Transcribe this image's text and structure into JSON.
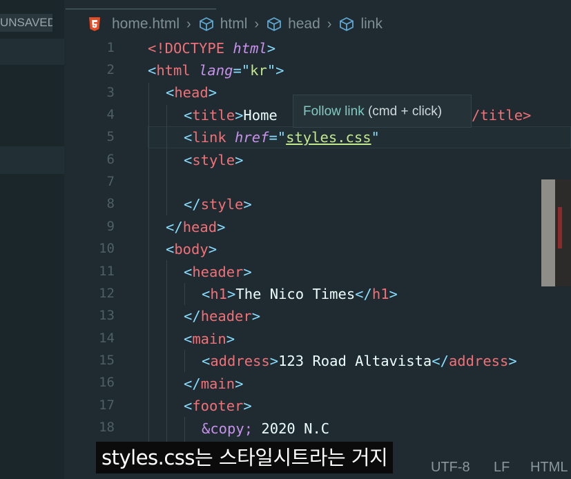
{
  "sidebar": {
    "unsaved_label": "UNSAVED"
  },
  "breadcrumb": {
    "file": "home.html",
    "items": [
      "html",
      "head",
      "link"
    ]
  },
  "line_numbers": [
    "1",
    "2",
    "3",
    "4",
    "5",
    "6",
    "7",
    "8",
    "9",
    "10",
    "11",
    "12",
    "13",
    "14",
    "15",
    "16",
    "17",
    "18"
  ],
  "code": {
    "l1": {
      "open": "<!DOCTYPE ",
      "kw": "html",
      "close": ">"
    },
    "l2": {
      "lt": "<",
      "tag": "html",
      "attr": " lang",
      "eq": "=",
      "q1": "\"",
      "val": "kr",
      "q2": "\"",
      "gt": ">"
    },
    "l3": {
      "lt": "<",
      "tag": "head",
      "gt": ">"
    },
    "l4": {
      "lt": "<",
      "tag": "title",
      "gt": ">",
      "text": "Home",
      "tail": "/title>"
    },
    "l5": {
      "lt": "<",
      "tag": "link",
      "attr": " href",
      "eq": "=",
      "q1": "\"",
      "val": "styles.css",
      "q2": "\""
    },
    "l6": {
      "lt": "<",
      "tag": "style",
      "gt": ">"
    },
    "l8": {
      "lt": "</",
      "tag": "style",
      "gt": ">"
    },
    "l9": {
      "lt": "</",
      "tag": "head",
      "gt": ">"
    },
    "l10": {
      "lt": "<",
      "tag": "body",
      "gt": ">"
    },
    "l11": {
      "lt": "<",
      "tag": "header",
      "gt": ">"
    },
    "l12": {
      "lt": "<",
      "tag": "h1",
      "gt": ">",
      "text": "The Nico Times",
      "lt2": "</",
      "tag2": "h1",
      "gt2": ">"
    },
    "l13": {
      "lt": "</",
      "tag": "header",
      "gt": ">"
    },
    "l14": {
      "lt": "<",
      "tag": "main",
      "gt": ">"
    },
    "l15": {
      "lt": "<",
      "tag": "address",
      "gt": ">",
      "text": "123 Road Altavista",
      "lt2": "</",
      "tag2": "address",
      "gt2": ">"
    },
    "l16": {
      "lt": "</",
      "tag": "main",
      "gt": ">"
    },
    "l17": {
      "lt": "<",
      "tag": "footer",
      "gt": ">"
    },
    "l18": {
      "ent": "&copy;",
      "text": " 2020 N.C"
    }
  },
  "tooltip": {
    "link": "Follow link",
    "hint": " (cmd + click)"
  },
  "statusbar": {
    "encoding": "UTF-8",
    "eol": "LF",
    "language": "HTML"
  },
  "subtitle": "styles.css는 스타일시트라는 거지",
  "colors": {
    "tag": "#f07178",
    "bracket": "#89ddff",
    "attr": "#c792ea",
    "string": "#c3e88d",
    "background": "#1f2b31"
  }
}
